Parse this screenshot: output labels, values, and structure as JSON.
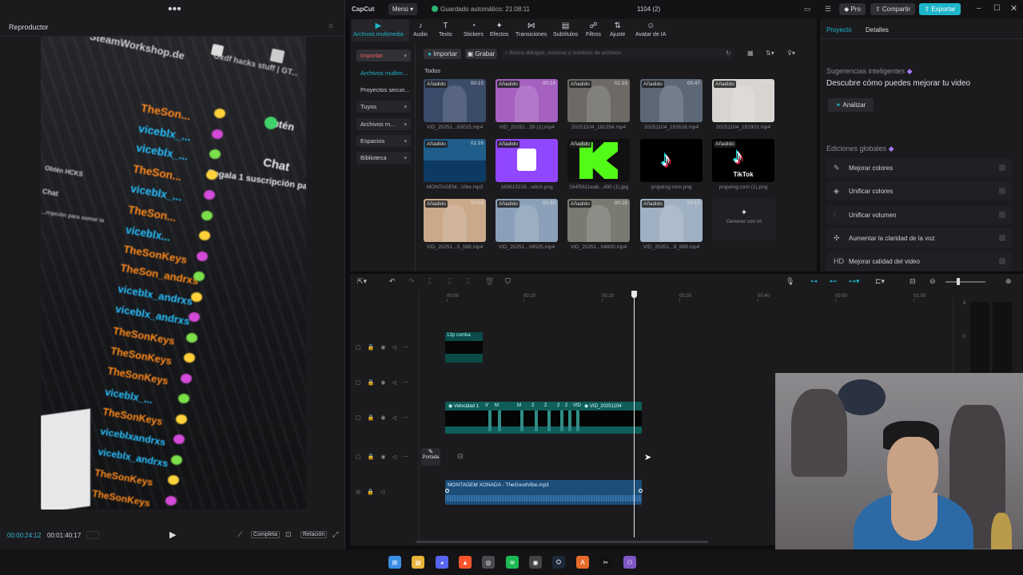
{
  "player": {
    "title": "Reproductor",
    "current_time": "00:00:24:12",
    "total_time": "00:01:40:17",
    "btn_full": "Completa",
    "btn_ratio": "Relación",
    "video_text": {
      "top1": "SteamWorkshop.de",
      "top2": "Oxdf hacks stuff | GT...",
      "obtain": "Obtén",
      "chat": "Chat",
      "chat2": "Chat",
      "obtain2": "Obtén HCKS",
      "sub_notice": "Regala 1 suscripción para posición 1",
      "sub_notice2": "...rripción para sumar la",
      "names": [
        "TheSon...",
        "viceblx_...",
        "viceblx_...",
        "TheSon...",
        "viceblx_...",
        "TheSon...",
        "viceblx...",
        "TheSonKeys",
        "TheSon_andrxs",
        "viceblx_andrxs",
        "viceblx_andrxs",
        "TheSonKeys",
        "TheSonKeys",
        "TheSonKeys",
        "viceblx_...",
        "TheSonKeys",
        "viceblxandrxs",
        "viceblx_andrxs",
        "TheSonKeys",
        "TheSonKeys",
        "TheSonKeys"
      ]
    }
  },
  "topbar": {
    "app": "CapCut",
    "menu": "Menú",
    "autosave": "Guardado automático: 21:08:11",
    "project": "1104 (2)",
    "pro": "Pro",
    "share": "Compartir",
    "export": "Exportar"
  },
  "toolbar": [
    {
      "icon": "▶",
      "label": "Archivos multimedia"
    },
    {
      "icon": "♪",
      "label": "Audio"
    },
    {
      "icon": "T",
      "label": "Texto"
    },
    {
      "icon": "◔",
      "label": "Stickers"
    },
    {
      "icon": "✦",
      "label": "Efectos"
    },
    {
      "icon": "⋈",
      "label": "Transiciones"
    },
    {
      "icon": "▤",
      "label": "Subtítulos"
    },
    {
      "icon": "☍",
      "label": "Filtros"
    },
    {
      "icon": "⇅",
      "label": "Ajuste"
    },
    {
      "icon": "☺",
      "label": "Avatar de IA"
    }
  ],
  "media_side": {
    "import": "Importar",
    "items": [
      "Archivos multim...",
      "Proyectos secun...",
      "Tuyos",
      "Archivos m...",
      "Espacios",
      "Biblioteca"
    ]
  },
  "media_bar": {
    "import": "Importar",
    "record": "Grabar",
    "search_placeholder": "Busca diálogos, escenas o nombres de archivos",
    "all": "Todos"
  },
  "media_items": [
    {
      "added": "Añadido",
      "dur": "00:15",
      "name": "VID_20251...83015.mp4",
      "color": "#3b4b6a"
    },
    {
      "added": "Añadido",
      "dur": "00:14",
      "name": "VID_20251...39 (1).mp4",
      "color": "#a560c0"
    },
    {
      "added": "Añadido",
      "dur": "01:19",
      "name": "20251104_191254.mp4",
      "color": "#6d6a66"
    },
    {
      "added": "Añadido",
      "dur": "00:47",
      "name": "20251104_191618.mp4",
      "color": "#5c6876"
    },
    {
      "added": "Añadido",
      "dur": "01:57",
      "name": "20251104_191903.mp4",
      "color": "#d8d4d0"
    },
    {
      "added": "Añadido",
      "dur": "01:16",
      "name": "MONTAGEM...Vibe.mp3",
      "color": "#1f5d8a"
    },
    {
      "added": "Añadido",
      "dur": "",
      "name": "165615226...witch.png",
      "color": "#9146ff"
    },
    {
      "added": "Añadido",
      "dur": "",
      "name": "164f5611eab...490 (1).jpg",
      "color": "#111111"
    },
    {
      "added": "",
      "dur": "",
      "name": "pngwing.com.png",
      "color": "#000000"
    },
    {
      "added": "Añadido",
      "dur": "",
      "name": "pngwing.com (1).png",
      "color": "#000000"
    },
    {
      "added": "Añadido",
      "dur": "00:08",
      "name": "VID_20251...5_588.mp4",
      "color": "#c9a98a"
    },
    {
      "added": "Añadido",
      "dur": "00:30",
      "name": "VID_20251...04525.mp4",
      "color": "#8ba0b8"
    },
    {
      "added": "Añadido",
      "dur": "00:29",
      "name": "VID_20251...04600.mp4",
      "color": "#7a7a72"
    },
    {
      "added": "Añadido",
      "dur": "00:15",
      "name": "VID_20251...8_899.mp4",
      "color": "#9fb0c2"
    }
  ],
  "generate_ai": "Generar con IA",
  "thumb_tiktok": "TikTok",
  "right": {
    "tab_project": "Proyecto",
    "tab_details": "Detalles",
    "suggest_title": "Sugerencias inteligentes",
    "suggest_sub": "Descubre cómo puedes mejorar tu video",
    "analyze": "Analizar",
    "global_title": "Ediciones globales",
    "global_items": [
      {
        "icon": "✎",
        "label": "Mejorar colores"
      },
      {
        "icon": "◈",
        "label": "Unificar colores"
      },
      {
        "icon": "⫶",
        "label": "Unificar volumen"
      },
      {
        "icon": "✣",
        "label": "Aumentar la claridad de la voz"
      },
      {
        "icon": "HD",
        "label": "Mejorar calidad del video"
      }
    ]
  },
  "timeline": {
    "ruler": [
      "00:00",
      "00:10",
      "00:20",
      "00:30",
      "00:40",
      "00:50",
      "01:00"
    ],
    "vu_labels": [
      "6",
      "0"
    ],
    "text_clip": "13p comba",
    "video_clip": "Velocidad 1",
    "video_clip2": "VID_20251104",
    "video_clip_marks": [
      "V",
      "M",
      "M",
      "2",
      "2",
      "2",
      "2",
      "VID"
    ],
    "cover_label": "Portada",
    "audio_clip": "MONTAGEM XONADA - TheGoodVibe.mp3"
  },
  "taskbar": [
    "start",
    "files",
    "discord",
    "brave",
    "chrome",
    "spotify",
    "obs",
    "steam",
    "office",
    "capcut",
    "vpn"
  ]
}
